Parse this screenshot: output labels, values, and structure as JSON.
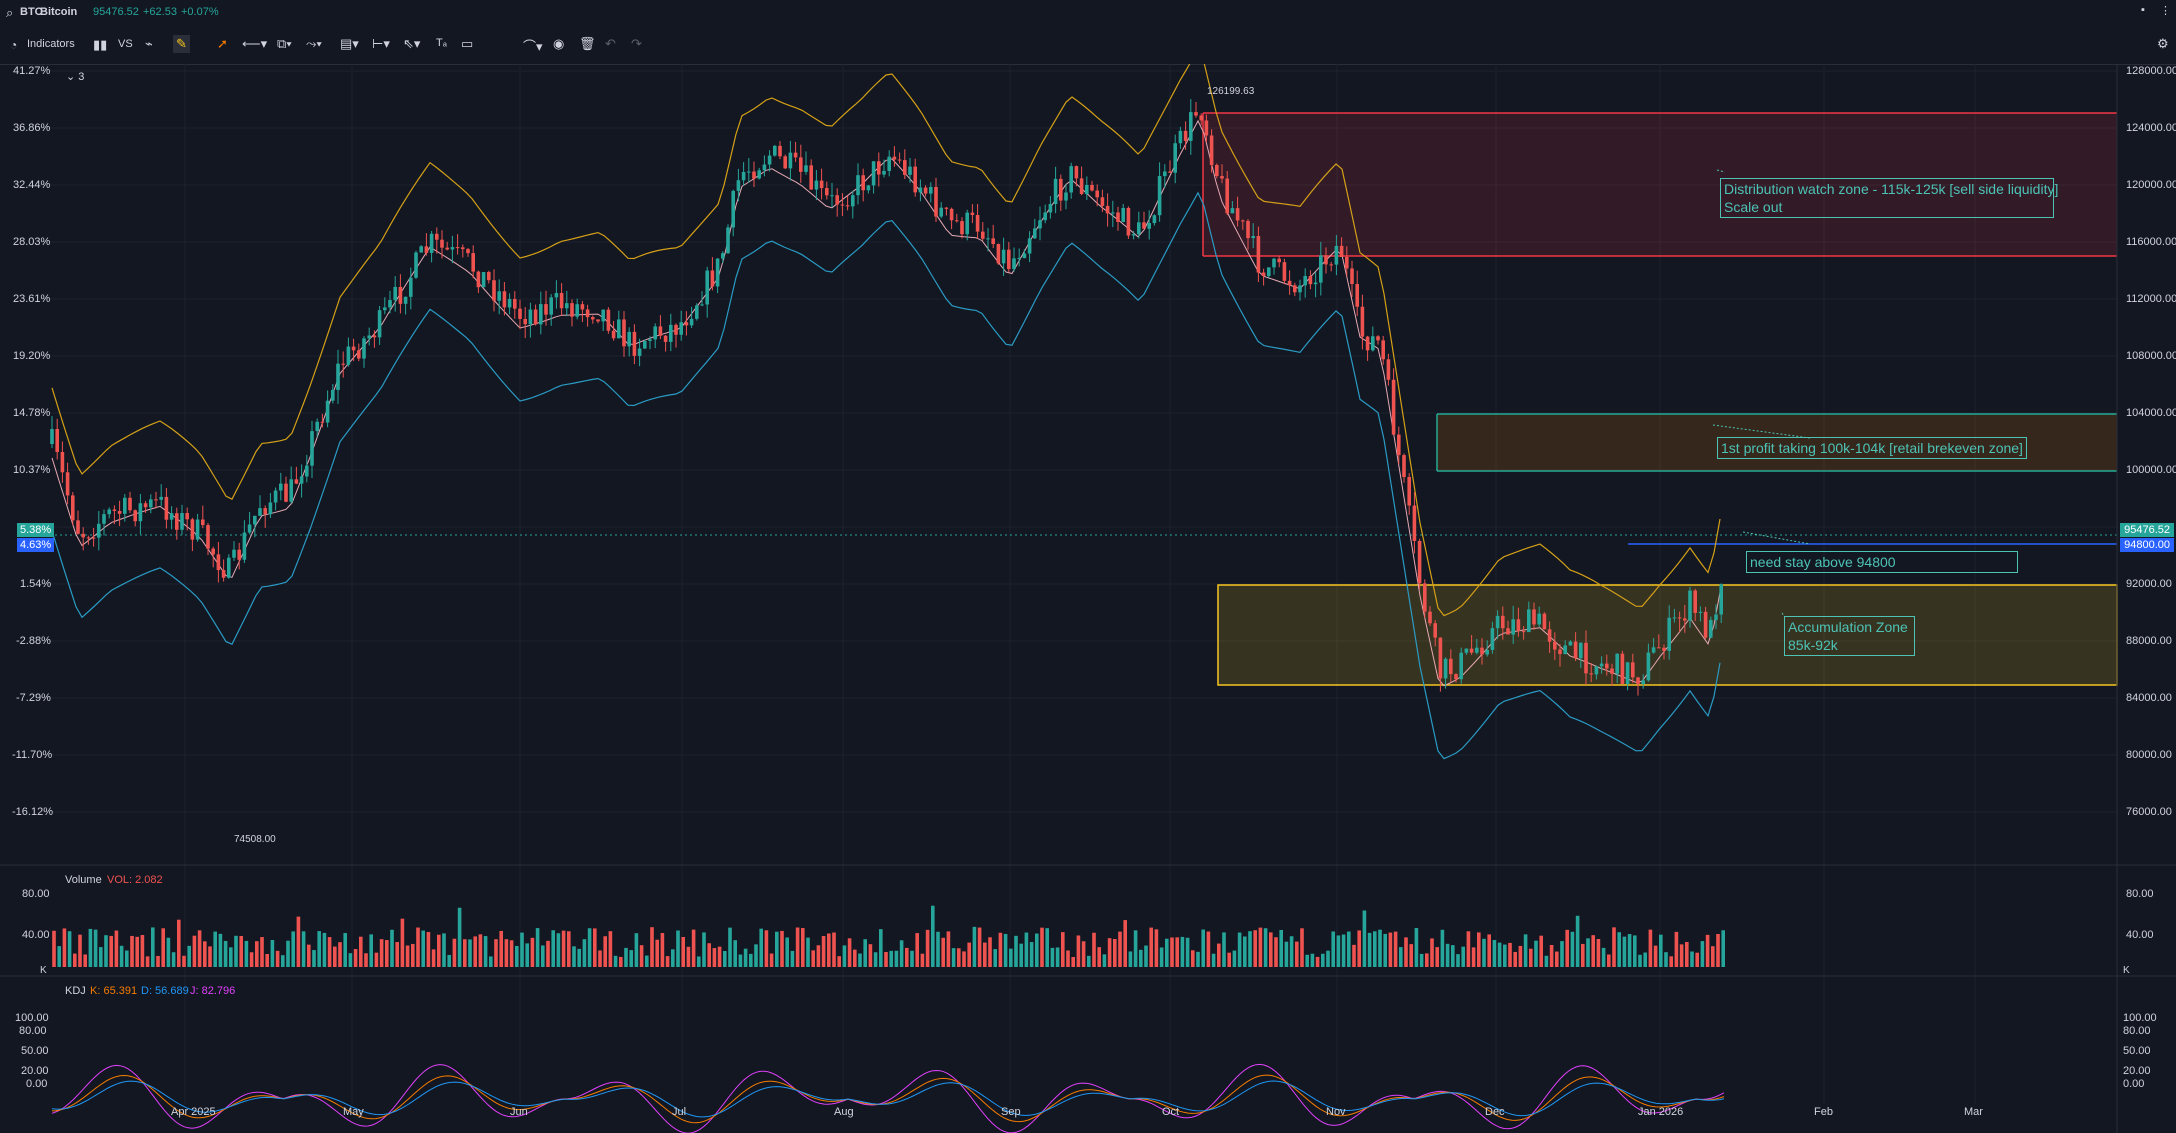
{
  "header": {
    "symbol": "BTC",
    "name": "Bitcoin",
    "price": "95476.52",
    "change": "+62.53",
    "change_pct": "+0.07%"
  },
  "toolbar": {
    "indicators_label": "Indicators",
    "vs_label": "VS",
    "layers_count": "3"
  },
  "right_axis": {
    "labels": [
      "128000.00",
      "124000.00",
      "120000.00",
      "116000.00",
      "112000.00",
      "108000.00",
      "104000.00",
      "100000.00",
      "92000.00",
      "88000.00",
      "84000.00",
      "80000.00",
      "76000.00"
    ],
    "current_price": "95476.52",
    "line_price": "94800.00"
  },
  "left_axis": {
    "labels": [
      "41.27%",
      "36.86%",
      "32.44%",
      "28.03%",
      "23.61%",
      "19.20%",
      "14.78%",
      "10.37%",
      "1.54%",
      "-2.88%",
      "-7.29%",
      "-11.70%",
      "-16.12%"
    ],
    "badge_green": "5.38%",
    "badge_blue": "4.63%"
  },
  "x_axis": {
    "labels": [
      "Apr 2025",
      "May",
      "Jun",
      "Jul",
      "Aug",
      "Sep",
      "Oct",
      "Nov",
      "Dec",
      "Jan 2026",
      "Feb",
      "Mar"
    ]
  },
  "price_labels": {
    "high": "126199.63",
    "low": "74508.00"
  },
  "annotations": {
    "distribution_line1": "Distribution watch zone - 115k-125k [sell side liquidity]",
    "distribution_line2": "Scale out",
    "profit_taking": "1st profit taking 100k-104k [retail brekeven zone]",
    "stay_above": "need stay above 94800",
    "accumulation_line1": "Accumulation Zone",
    "accumulation_line2": "85k-92k"
  },
  "volume_pane": {
    "title": "Volume",
    "vol_value": "VOL: 2.082",
    "axis": [
      "80.00",
      "40.00"
    ],
    "k_label": "K"
  },
  "kdj_pane": {
    "title": "KDJ",
    "k": "K: 65.391",
    "d": "D: 56.689",
    "j": "J: 82.796",
    "axis": [
      "100.00",
      "80.00",
      "50.00",
      "20.00",
      "0.00"
    ]
  },
  "colors": {
    "up": "#26a69a",
    "down": "#ef5350",
    "distribution": "#f23645",
    "profit": "#22ab94",
    "accumulation": "#f7c61f",
    "blue_line": "#2962ff"
  },
  "icons": [
    "search-icon",
    "candles-icon",
    "compare-icon",
    "drawing-icon",
    "cursor-icon",
    "trend-line-icon",
    "measure-icon",
    "text-icon",
    "comment-icon",
    "eye-icon",
    "trash-icon",
    "undo-icon",
    "redo-icon",
    "settings-icon",
    "layout-icon"
  ]
}
